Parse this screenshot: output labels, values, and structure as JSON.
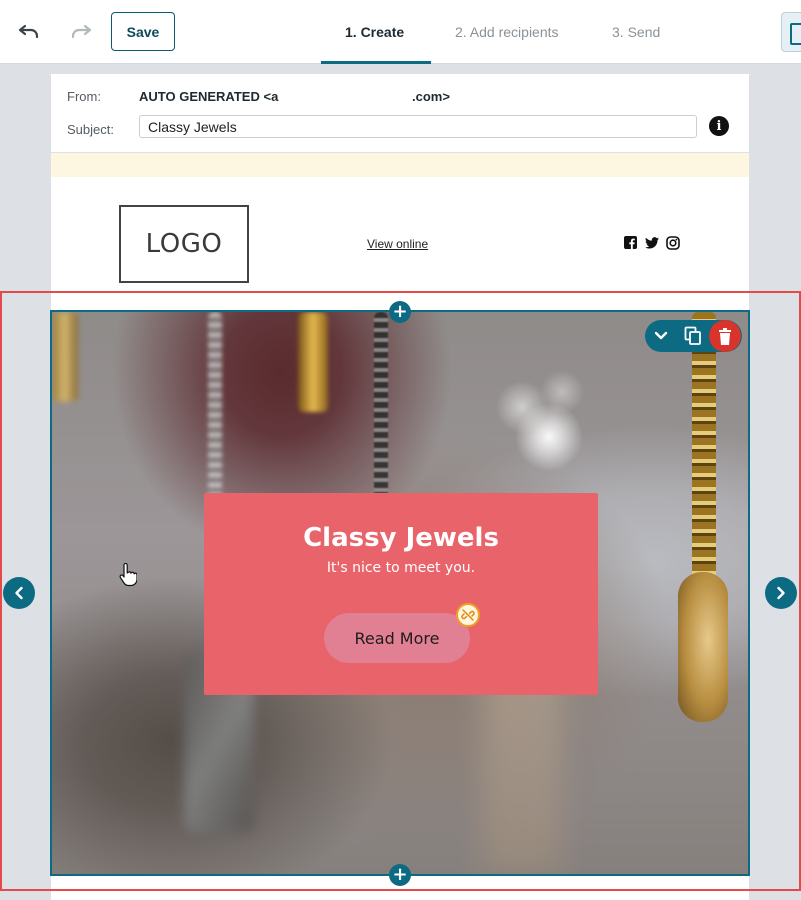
{
  "toolbar": {
    "undo_icon": "undo-icon",
    "redo_icon": "redo-icon",
    "save_label": "Save",
    "steps": [
      {
        "label": "1. Create",
        "active": true
      },
      {
        "label": "2. Add recipients",
        "active": false
      },
      {
        "label": "3. Send",
        "active": false
      }
    ]
  },
  "email": {
    "from_label": "From:",
    "from_value": "AUTO GENERATED <a",
    "from_domain": ".com>",
    "subject_label": "Subject:",
    "subject_value": "Classy Jewels",
    "info_icon": "info-icon"
  },
  "header_block": {
    "logo_text": "LOGO",
    "view_online": "View online",
    "social_icons": [
      "facebook-icon",
      "twitter-icon",
      "instagram-icon"
    ]
  },
  "hero": {
    "title": "Classy Jewels",
    "subtitle": "It's nice to meet you.",
    "button_label": "Read More"
  },
  "colors": {
    "accent": "#0c6b82",
    "selection_outline": "#e34b4b",
    "hero_card": "#e8646a",
    "hero_button": "#e17f93",
    "delete": "#d9342b"
  }
}
